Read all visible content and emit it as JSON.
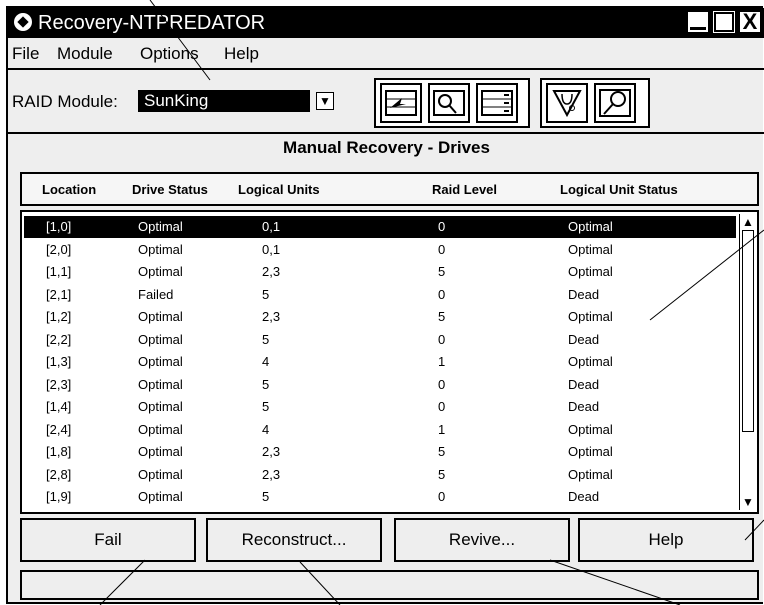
{
  "window": {
    "title": "Recovery-NTPREDATOR"
  },
  "menubar": {
    "items": [
      "File",
      "Module",
      "Options",
      "Help"
    ]
  },
  "toolbar": {
    "raid_label": "RAID Module:",
    "raid_value": "SunKing"
  },
  "section_title": "Manual Recovery - Drives",
  "table": {
    "columns": [
      "Location",
      "Drive Status",
      "Logical Units",
      "Raid Level",
      "Logical Unit Status"
    ],
    "rows": [
      [
        "[1,0]",
        "Optimal",
        "0,1",
        "0",
        "Optimal"
      ],
      [
        "[2,0]",
        "Optimal",
        "0,1",
        "0",
        "Optimal"
      ],
      [
        "[1,1]",
        "Optimal",
        "2,3",
        "5",
        "Optimal"
      ],
      [
        "[2,1]",
        "Failed",
        "5",
        "0",
        "Dead"
      ],
      [
        "[1,2]",
        "Optimal",
        "2,3",
        "5",
        "Optimal"
      ],
      [
        "[2,2]",
        "Optimal",
        "5",
        "0",
        "Dead"
      ],
      [
        "[1,3]",
        "Optimal",
        "4",
        "1",
        "Optimal"
      ],
      [
        "[2,3]",
        "Optimal",
        "5",
        "0",
        "Dead"
      ],
      [
        "[1,4]",
        "Optimal",
        "5",
        "0",
        "Dead"
      ],
      [
        "[2,4]",
        "Optimal",
        "4",
        "1",
        "Optimal"
      ],
      [
        "[1,8]",
        "Optimal",
        "2,3",
        "5",
        "Optimal"
      ],
      [
        "[2,8]",
        "Optimal",
        "2,3",
        "5",
        "Optimal"
      ],
      [
        "[1,9]",
        "Optimal",
        "5",
        "0",
        "Dead"
      ]
    ],
    "selected_row": 0
  },
  "buttons": {
    "fail": "Fail",
    "reconstruct": "Reconstruct...",
    "revive": "Revive...",
    "help": "Help"
  },
  "icons": [
    "configuration-icon",
    "status-icon",
    "recovery-icon",
    "maintenance-icon",
    "about-icon"
  ]
}
